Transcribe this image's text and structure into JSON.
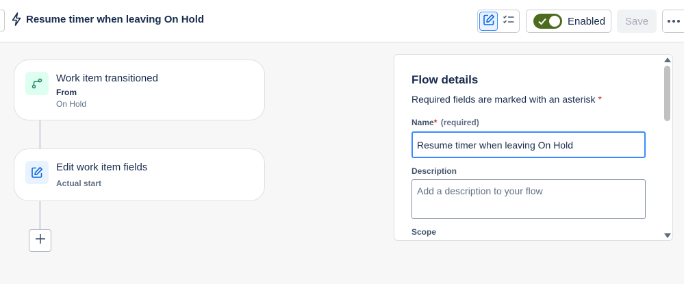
{
  "header": {
    "flow_title": "Resume timer when leaving On Hold",
    "title_icon": "lightning-bolt-icon",
    "view_toggle": {
      "edit_icon": "edit-icon",
      "checklist_icon": "checklist-icon"
    },
    "enabled_label": "Enabled",
    "enabled_state": true,
    "save_label": "Save",
    "more_icon": "more-horizontal-icon"
  },
  "canvas": {
    "trigger": {
      "icon": "transition-icon",
      "title": "Work item transitioned",
      "from_label": "From",
      "from_value": "On Hold"
    },
    "action": {
      "icon": "edit-icon",
      "title": "Edit work item fields",
      "field": "Actual start"
    },
    "add_icon": "plus-icon"
  },
  "details": {
    "title": "Flow details",
    "note": "Required fields are marked with an asterisk",
    "asterisk": "*",
    "name_label": "Name",
    "name_hint": "(required)",
    "name_value": "Resume timer when leaving On Hold",
    "description_label": "Description",
    "description_placeholder": "Add a description to your flow",
    "scope_label": "Scope"
  },
  "colors": {
    "accent": "#388bff",
    "toggle_on": "#4c6b1f",
    "required": "#c9372c",
    "trigger_icon_bg": "#dcfff1",
    "action_icon_bg": "#e9f2ff"
  }
}
